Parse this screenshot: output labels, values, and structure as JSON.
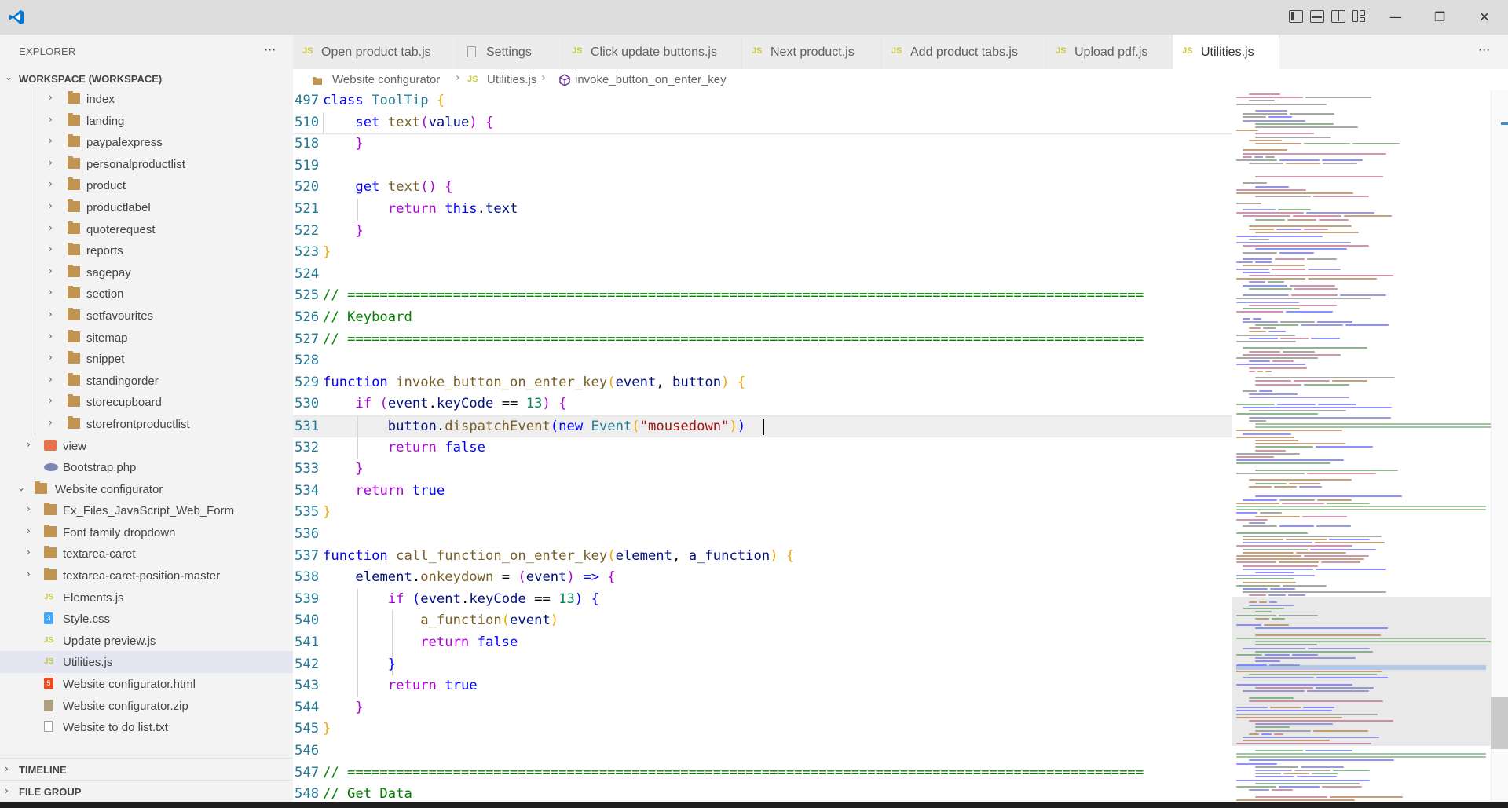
{
  "window": {
    "title_bar_controls": [
      "toggle-primary-sidebar-icon",
      "toggle-panel-icon",
      "toggle-secondary-sidebar-icon",
      "customize-layout-icon"
    ],
    "minimize": "—",
    "maximize": "❐",
    "close": "✕"
  },
  "sidebar": {
    "title": "EXPLORER",
    "more": "···",
    "workspace": "WORKSPACE (WORKSPACE)",
    "items": [
      {
        "label": "index",
        "type": "folder",
        "level": 2,
        "expanded": false
      },
      {
        "label": "landing",
        "type": "folder",
        "level": 2,
        "expanded": false
      },
      {
        "label": "paypalexpress",
        "type": "folder",
        "level": 2,
        "expanded": false
      },
      {
        "label": "personalproductlist",
        "type": "folder",
        "level": 2,
        "expanded": false
      },
      {
        "label": "product",
        "type": "folder",
        "level": 2,
        "expanded": false
      },
      {
        "label": "productlabel",
        "type": "folder",
        "level": 2,
        "expanded": false
      },
      {
        "label": "quoterequest",
        "type": "folder",
        "level": 2,
        "expanded": false
      },
      {
        "label": "reports",
        "type": "folder",
        "level": 2,
        "expanded": false
      },
      {
        "label": "sagepay",
        "type": "folder",
        "level": 2,
        "expanded": false
      },
      {
        "label": "section",
        "type": "folder",
        "level": 2,
        "expanded": false
      },
      {
        "label": "setfavourites",
        "type": "folder",
        "level": 2,
        "expanded": false
      },
      {
        "label": "sitemap",
        "type": "folder",
        "level": 2,
        "expanded": false
      },
      {
        "label": "snippet",
        "type": "folder",
        "level": 2,
        "expanded": false
      },
      {
        "label": "standingorder",
        "type": "folder",
        "level": 2,
        "expanded": false
      },
      {
        "label": "storecupboard",
        "type": "folder",
        "level": 2,
        "expanded": false
      },
      {
        "label": "storefrontproductlist",
        "type": "folder",
        "level": 2,
        "expanded": false
      },
      {
        "label": "view",
        "type": "view",
        "level": 1,
        "expanded": false
      },
      {
        "label": "Bootstrap.php",
        "type": "php",
        "level": 1
      },
      {
        "label": "Website configurator",
        "type": "folder-open",
        "level": 0,
        "expanded": true
      },
      {
        "label": "Ex_Files_JavaScript_Web_Form",
        "type": "folder",
        "level": 1,
        "expanded": false
      },
      {
        "label": "Font family dropdown",
        "type": "folder",
        "level": 1,
        "expanded": false
      },
      {
        "label": "textarea-caret",
        "type": "folder",
        "level": 1,
        "expanded": false
      },
      {
        "label": "textarea-caret-position-master",
        "type": "folder",
        "level": 1,
        "expanded": false
      },
      {
        "label": "Elements.js",
        "type": "js",
        "level": 1
      },
      {
        "label": "Style.css",
        "type": "css",
        "level": 1
      },
      {
        "label": "Update preview.js",
        "type": "js",
        "level": 1
      },
      {
        "label": "Utilities.js",
        "type": "js",
        "level": 1,
        "selected": true
      },
      {
        "label": "Website configurator.html",
        "type": "html",
        "level": 1
      },
      {
        "label": "Website configurator.zip",
        "type": "zip",
        "level": 1
      },
      {
        "label": "Website to do list.txt",
        "type": "txt",
        "level": 1
      }
    ],
    "timeline": "TIMELINE",
    "file_group": "FILE GROUP"
  },
  "tabs": [
    {
      "label": "Open product tab.js",
      "icon": "JS"
    },
    {
      "label": "Settings",
      "icon": "doc"
    },
    {
      "label": "Click update buttons.js",
      "icon": "JS"
    },
    {
      "label": "Next product.js",
      "icon": "JS"
    },
    {
      "label": "Add product tabs.js",
      "icon": "JS"
    },
    {
      "label": "Upload pdf.js",
      "icon": "JS"
    },
    {
      "label": "Utilities.js",
      "icon": "JS",
      "active": true
    }
  ],
  "tab_more": "···",
  "breadcrumb": {
    "folder": "Website configurator",
    "file": "Utilities.js",
    "file_icon": "JS",
    "symbol": "invoke_button_on_enter_key"
  },
  "editor": {
    "lines": [
      {
        "n": "497",
        "html": "<span class=\"k\">class</span> <span class=\"cls\">ToolTip</span> <span class=\"gold\">{</span>"
      },
      {
        "n": "510",
        "html": "    <span class=\"k\">set</span> <span class=\"fn\">text</span><span class=\"purple\">(</span><span class=\"var\">value</span><span class=\"purple\">)</span> <span class=\"purple\">{</span>"
      },
      {
        "n": "518",
        "html": "    <span class=\"purple\">}</span>"
      },
      {
        "n": "519",
        "html": ""
      },
      {
        "n": "520",
        "html": "    <span class=\"k\">get</span> <span class=\"fn\">text</span><span class=\"purple\">()</span> <span class=\"purple\">{</span>"
      },
      {
        "n": "521",
        "html": "        <span class=\"kc\">return</span> <span class=\"k\">this</span>.<span class=\"var\">text</span>"
      },
      {
        "n": "522",
        "html": "    <span class=\"purple\">}</span>"
      },
      {
        "n": "523",
        "html": "<span class=\"gold\">}</span>"
      },
      {
        "n": "524",
        "html": ""
      },
      {
        "n": "525",
        "html": "<span class=\"cm\">// ==================================================================================================</span>"
      },
      {
        "n": "526",
        "html": "<span class=\"cm\">// Keyboard</span>"
      },
      {
        "n": "527",
        "html": "<span class=\"cm\">// ==================================================================================================</span>"
      },
      {
        "n": "528",
        "html": ""
      },
      {
        "n": "529",
        "html": "<span class=\"k\">function</span> <span class=\"fn\">invoke_button_on_enter_key</span><span class=\"gold\">(</span><span class=\"var\">event</span>, <span class=\"var\">button</span><span class=\"gold\">)</span> <span class=\"gold\">{</span>"
      },
      {
        "n": "530",
        "html": "    <span class=\"kc\">if</span> <span class=\"purple\">(</span><span class=\"var\">event</span>.<span class=\"var\">keyCode</span> == <span class=\"num\">13</span><span class=\"purple\">)</span> <span class=\"purple\">{</span>"
      },
      {
        "n": "531",
        "html": "        <span class=\"var\">button</span>.<span class=\"fn\">dispatchEvent</span><span class=\"blue\">(</span><span class=\"k\">new</span> <span class=\"cls\">Event</span><span class=\"gold\">(</span><span class=\"str\">\"mousedown\"</span><span class=\"gold\">)</span><span class=\"blue\">)</span>",
        "current": true
      },
      {
        "n": "532",
        "html": "        <span class=\"kc\">return</span> <span class=\"k\">false</span>"
      },
      {
        "n": "533",
        "html": "    <span class=\"purple\">}</span>"
      },
      {
        "n": "534",
        "html": "    <span class=\"kc\">return</span> <span class=\"k\">true</span>"
      },
      {
        "n": "535",
        "html": "<span class=\"gold\">}</span>"
      },
      {
        "n": "536",
        "html": ""
      },
      {
        "n": "537",
        "html": "<span class=\"k\">function</span> <span class=\"fn\">call_function_on_enter_key</span><span class=\"gold\">(</span><span class=\"var\">element</span>, <span class=\"var\">a_function</span><span class=\"gold\">)</span> <span class=\"gold\">{</span>"
      },
      {
        "n": "538",
        "html": "    <span class=\"var\">element</span>.<span class=\"fn\">onkeydown</span> = <span class=\"purple\">(</span><span class=\"var\">event</span><span class=\"purple\">)</span> <span class=\"k\">=&gt;</span> <span class=\"purple\">{</span>"
      },
      {
        "n": "539",
        "html": "        <span class=\"kc\">if</span> <span class=\"blue\">(</span><span class=\"var\">event</span>.<span class=\"var\">keyCode</span> == <span class=\"num\">13</span><span class=\"blue\">)</span> <span class=\"blue\">{</span>"
      },
      {
        "n": "540",
        "html": "            <span class=\"fn\">a_function</span><span class=\"gold\">(</span><span class=\"var\">event</span><span class=\"gold\">)</span>"
      },
      {
        "n": "541",
        "html": "            <span class=\"kc\">return</span> <span class=\"k\">false</span>"
      },
      {
        "n": "542",
        "html": "        <span class=\"blue\">}</span>"
      },
      {
        "n": "543",
        "html": "        <span class=\"kc\">return</span> <span class=\"k\">true</span>"
      },
      {
        "n": "544",
        "html": "    <span class=\"purple\">}</span>"
      },
      {
        "n": "545",
        "html": "<span class=\"gold\">}</span>"
      },
      {
        "n": "546",
        "html": ""
      },
      {
        "n": "547",
        "html": "<span class=\"cm\">// ==================================================================================================</span>"
      },
      {
        "n": "548",
        "html": "<span class=\"cm\">// Get Data</span>"
      }
    ]
  },
  "colors": {
    "accent": "#007acc",
    "folder": "#c09553",
    "js": "#cbcb41",
    "comment": "#008000",
    "keyword": "#0000ff"
  }
}
